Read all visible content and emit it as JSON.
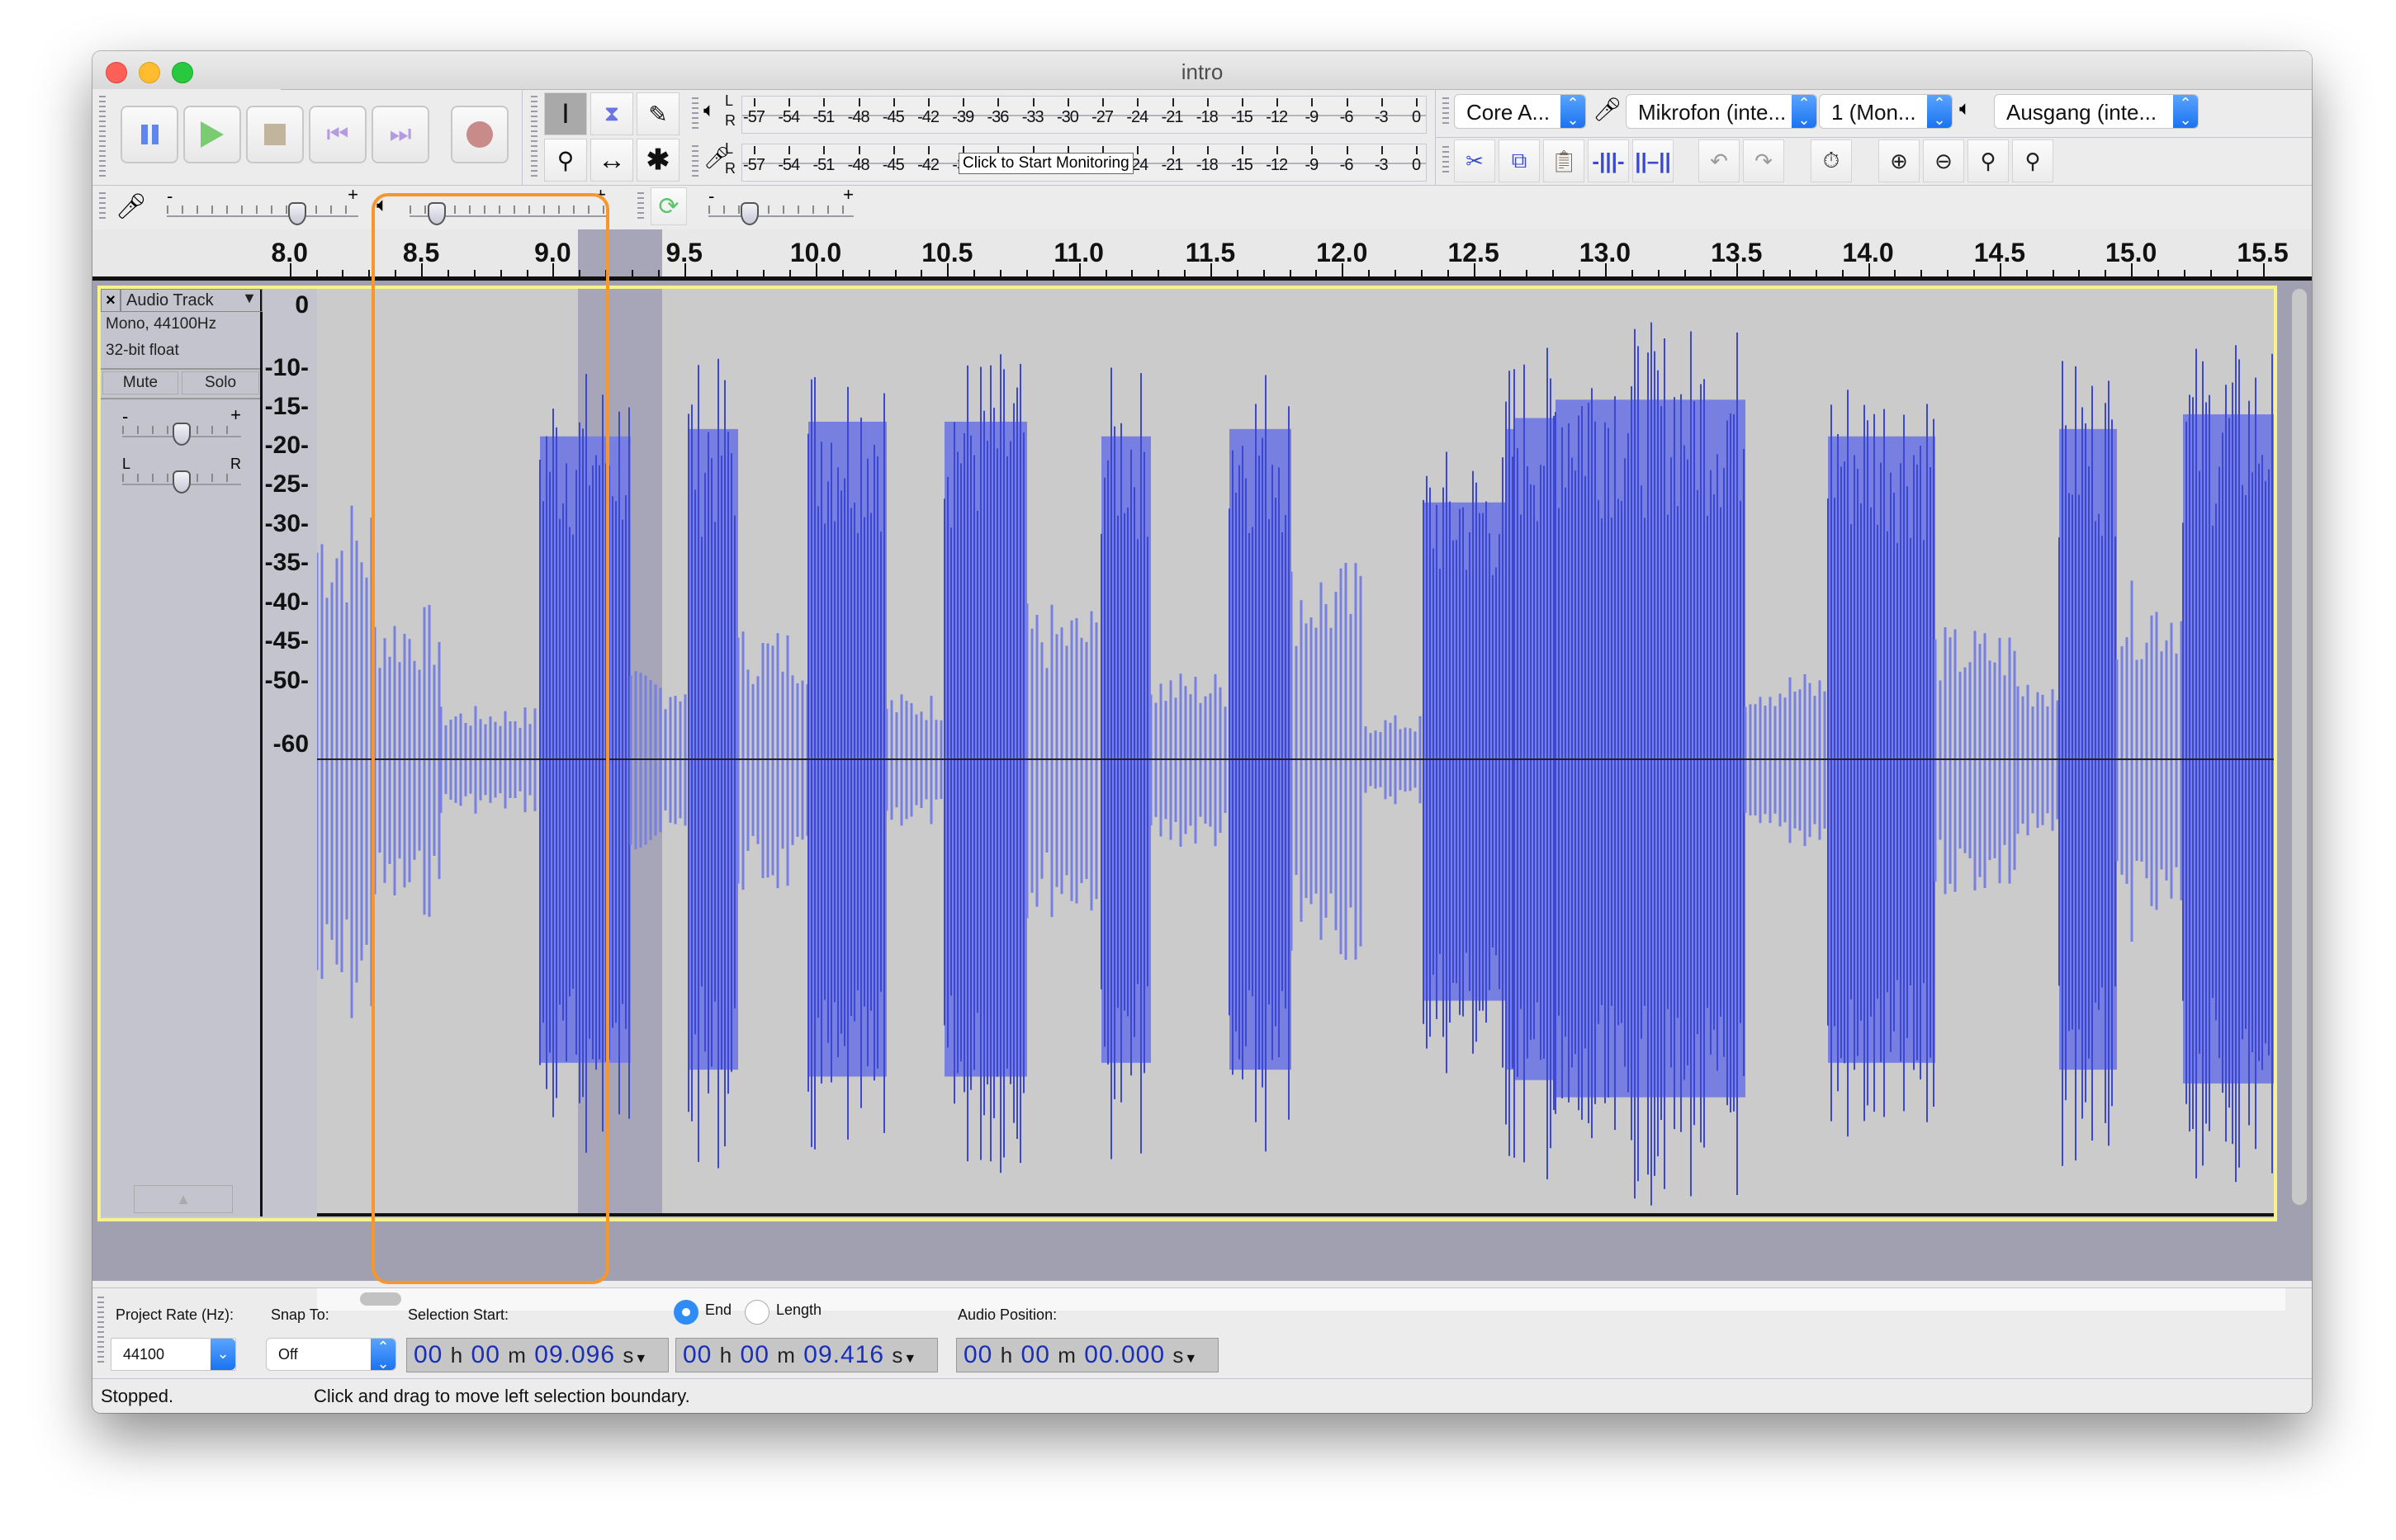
{
  "window": {
    "title": "intro"
  },
  "transport": {
    "buttons": [
      {
        "name": "pause",
        "label": "Pause"
      },
      {
        "name": "play",
        "label": "Play"
      },
      {
        "name": "stop",
        "label": "Stop"
      },
      {
        "name": "skip-start",
        "label": "Skip to Start"
      },
      {
        "name": "skip-end",
        "label": "Skip to End"
      },
      {
        "name": "record",
        "label": "Record"
      }
    ]
  },
  "tools": {
    "items": [
      "selection-tool",
      "envelope-tool",
      "draw-tool",
      "zoom-tool",
      "time-shift-tool",
      "multi-tool"
    ],
    "active": "selection-tool"
  },
  "meters": {
    "ticks": [
      "-57",
      "-54",
      "-51",
      "-48",
      "-45",
      "-42",
      "-39",
      "-36",
      "-33",
      "-30",
      "-27",
      "-24",
      "-21",
      "-18",
      "-15",
      "-12",
      "-9",
      "-6",
      "-3",
      "0"
    ],
    "channel_left": "L",
    "channel_right": "R",
    "record_meter_tooltip": "Click to Start Monitoring"
  },
  "device": {
    "host": "Core A...",
    "recording_device": "Mikrofon (inte...",
    "channels": "1 (Mon...",
    "playback_device": "Ausgang (inte..."
  },
  "mixer": {
    "minus": "-",
    "plus": "+",
    "recording_volume": 0.7,
    "playback_volume": 0.1,
    "play_at_speed": 0.25
  },
  "ruler": {
    "labels": [
      "8.0",
      "8.5",
      "9.0",
      "9.5",
      "10.0",
      "10.5",
      "11.0",
      "11.5",
      "12.0",
      "12.5",
      "13.0",
      "13.5",
      "14.0",
      "14.5",
      "15.0",
      "15.5"
    ],
    "view_start": 7.96,
    "view_end": 15.58
  },
  "track": {
    "name": "Audio Track",
    "info_line1": "Mono, 44100Hz",
    "info_line2": "32-bit float",
    "mute_label": "Mute",
    "solo_label": "Solo",
    "gain_minus": "-",
    "gain_plus": "+",
    "pan_left": "L",
    "pan_right": "R",
    "gain": 0.5,
    "pan": 0.5,
    "db_scale": [
      "0",
      "-10",
      "-15",
      "-20",
      "-25",
      "-30",
      "-35",
      "-40",
      "-45",
      "-50",
      "-60"
    ],
    "waveform_color": "#7780e0",
    "waveform_peak_color": "#3c48d4",
    "selection": {
      "start": 9.096,
      "end": 9.416
    }
  },
  "selection_toolbar": {
    "project_rate_label": "Project Rate (Hz):",
    "project_rate_value": "44100",
    "snap_to_label": "Snap To:",
    "snap_to_value": "Off",
    "selection_start_label": "Selection Start:",
    "end_radio_label": "End",
    "length_radio_label": "Length",
    "end_selected": true,
    "audio_position_label": "Audio Position:",
    "selection_start": {
      "h": "00",
      "m": "00",
      "s": "09.096"
    },
    "selection_end": {
      "h": "00",
      "m": "00",
      "s": "09.416"
    },
    "audio_position": {
      "h": "00",
      "m": "00",
      "s": "00.000"
    },
    "units": {
      "h": "h",
      "m": "m",
      "s": "s"
    }
  },
  "status": {
    "state": "Stopped.",
    "hint": "Click and drag to move left selection boundary."
  },
  "annotation": {
    "color": "#f8952b"
  }
}
